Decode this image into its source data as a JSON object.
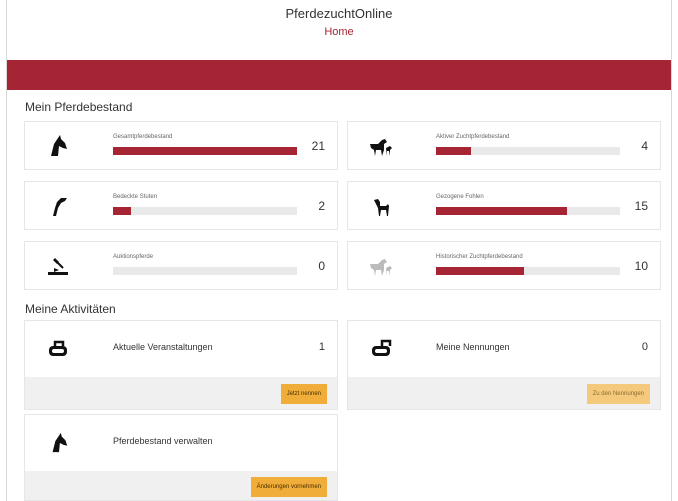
{
  "header": {
    "app_title": "PferdezuchtOnline",
    "nav_home": "Home"
  },
  "sections": {
    "stock_title": "Mein Pferdebestand",
    "activities_title": "Meine Aktivitäten"
  },
  "stats": [
    {
      "label": "Gesamtpferdebestand",
      "value": "21",
      "fill_fraction": 1.0,
      "icon": "horse-head-icon"
    },
    {
      "label": "Aktiver Zuchtpferdebestand",
      "value": "4",
      "fill_fraction": 0.19,
      "icon": "mare-foal-icon"
    },
    {
      "label": "Bedeckte Stuten",
      "value": "2",
      "fill_fraction": 0.1,
      "icon": "covered-mare-icon"
    },
    {
      "label": "Gezogene Fohlen",
      "value": "15",
      "fill_fraction": 0.71,
      "icon": "foal-icon"
    },
    {
      "label": "Auktionspferde",
      "value": "0",
      "fill_fraction": 0.0,
      "icon": "auction-gavel-icon"
    },
    {
      "label": "Historischer Zuchtpferdebestand",
      "value": "10",
      "fill_fraction": 0.48,
      "icon": "historic-horse-icon"
    }
  ],
  "activities": [
    {
      "label": "Aktuelle Veranstaltungen",
      "count": "1",
      "button": "Jetzt nennen",
      "icon": "horseshoe-icon",
      "button_disabled": false
    },
    {
      "label": "Meine Nennungen",
      "count": "0",
      "button": "Zu den Nennungen",
      "icon": "horseshoe-icon",
      "button_disabled": true
    },
    {
      "label": "Pferdebestand verwalten",
      "count": "",
      "button": "Änderungen vornehmen",
      "icon": "horse-head-icon",
      "button_disabled": false
    }
  ],
  "colors": {
    "brand": "#a52535",
    "button": "#f0ad3a",
    "track": "#e9e9e9"
  }
}
